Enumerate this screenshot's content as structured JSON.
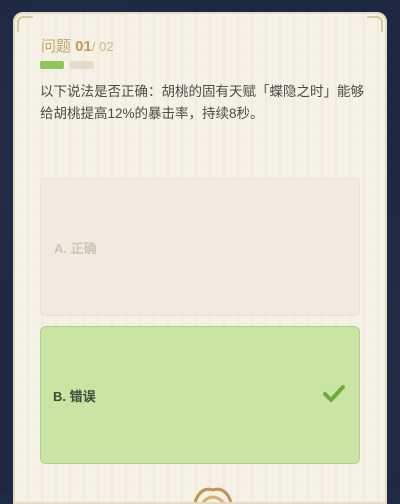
{
  "quiz": {
    "question_prefix": "问题 ",
    "current": "01",
    "total": "/ 02",
    "progress": {
      "current_index": 1,
      "total_count": 2
    },
    "question_text": "以下说法是否正确：胡桃的固有天赋「蝶隐之时」能够给胡桃提高12%的暴击率，持续8秒。",
    "options": [
      {
        "label": "A. 正确",
        "selected": false
      },
      {
        "label": "B. 错误",
        "selected": true
      }
    ],
    "selected_icon": "checkmark-icon"
  },
  "colors": {
    "background": "#1e2842",
    "card": "#f6f1e6",
    "selected_option": "#c8e5a3",
    "check": "#6cae38",
    "progress_done": "#8fc65a"
  }
}
